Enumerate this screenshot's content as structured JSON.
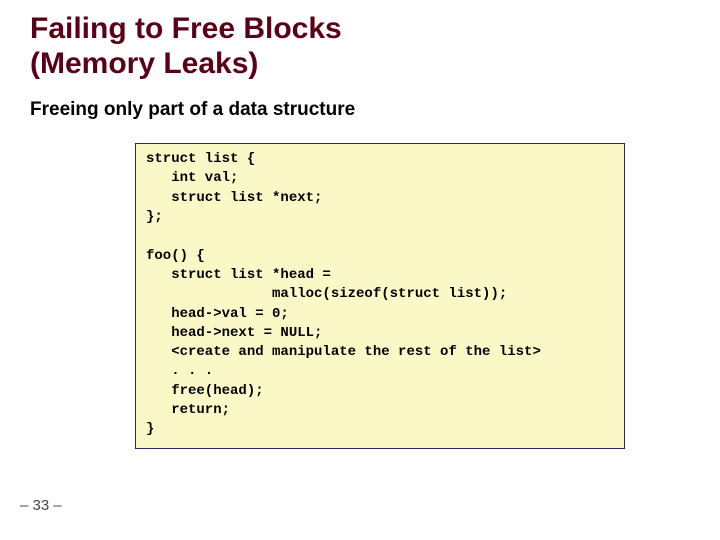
{
  "slide": {
    "title_line1": "Failing to Free Blocks",
    "title_line2": "(Memory Leaks)",
    "subtitle": "Freeing only part of a data structure",
    "code": "struct list {\n   int val;\n   struct list *next;\n};\n\nfoo() {\n   struct list *head =\n               malloc(sizeof(struct list));\n   head->val = 0;\n   head->next = NULL;\n   <create and manipulate the rest of the list>\n   . . .\n   free(head);\n   return;\n}",
    "page": "– 33 –"
  }
}
